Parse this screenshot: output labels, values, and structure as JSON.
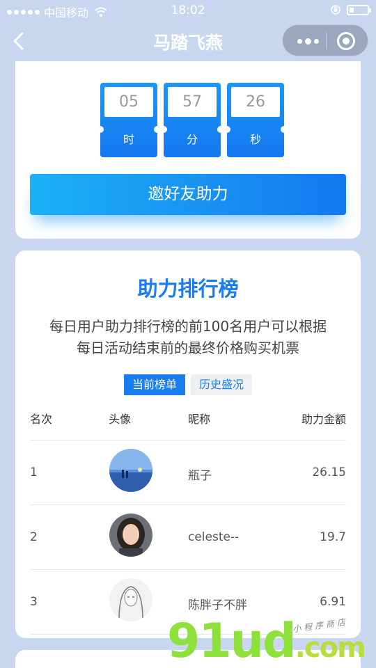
{
  "status": {
    "carrier": "中国移动",
    "time": "18:02"
  },
  "nav": {
    "title": "马踏飞燕"
  },
  "countdown": {
    "hours": "05",
    "hours_label": "时",
    "minutes": "57",
    "minutes_label": "分",
    "seconds": "26",
    "seconds_label": "秒"
  },
  "invite": {
    "label": "邀好友助力"
  },
  "ranking": {
    "title": "助力排行榜",
    "desc_line1": "每日用户助力排行榜的前100名用户可以根据",
    "desc_line2": "每日活动结束前的最终价格购买机票",
    "tabs": [
      {
        "label": "当前榜单",
        "active": true
      },
      {
        "label": "历史盛况",
        "active": false
      }
    ],
    "headers": {
      "rank": "名次",
      "avatar": "头像",
      "nickname": "昵称",
      "amount": "助力金额"
    },
    "rows": [
      {
        "rank": "1",
        "nickname": "瓶子",
        "amount": "26.15"
      },
      {
        "rank": "2",
        "nickname": "celeste--",
        "amount": "19.7"
      },
      {
        "rank": "3",
        "nickname": "陈胖子不胖",
        "amount": "6.91"
      }
    ]
  },
  "watermark": {
    "brand": "91ud",
    "suffix": ".com",
    "tagline": "小程序商店"
  },
  "colors": {
    "accent": "#1a7cee",
    "background": "#c9d6f0",
    "brand_green": "#8ee03a"
  }
}
